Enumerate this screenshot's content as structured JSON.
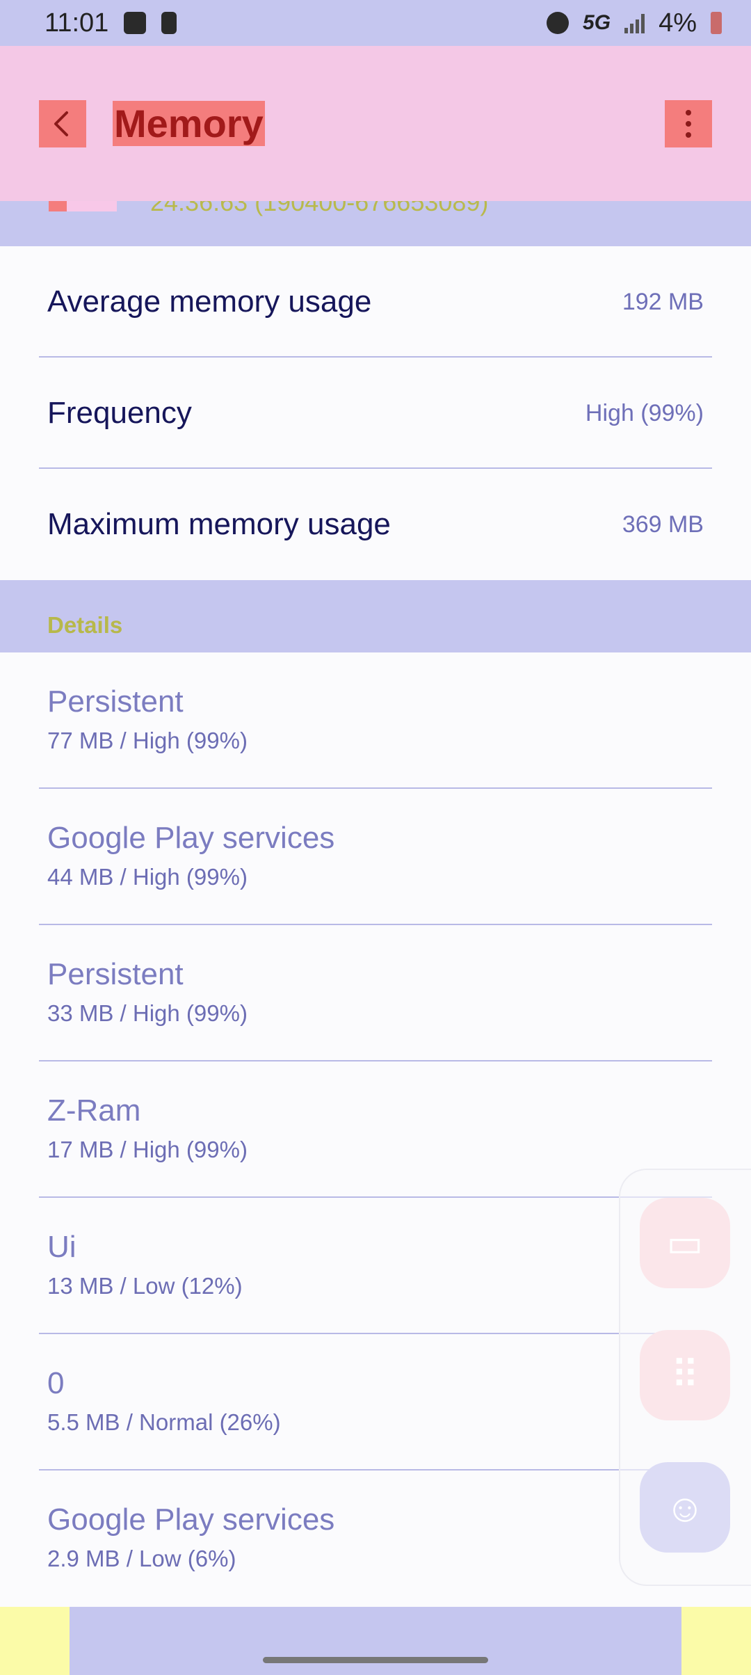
{
  "status_bar": {
    "time": "11:01",
    "network": "5G",
    "battery": "4%"
  },
  "header": {
    "title": "Memory"
  },
  "app_peek": {
    "version_text": "24.36.63 (190400-676653089)"
  },
  "summary": [
    {
      "label": "Average memory usage",
      "value": "192 MB"
    },
    {
      "label": "Frequency",
      "value": "High (99%)"
    },
    {
      "label": "Maximum memory usage",
      "value": "369 MB"
    }
  ],
  "details": {
    "title": "Details",
    "items": [
      {
        "name": "Persistent",
        "info": "77 MB / High (99%)"
      },
      {
        "name": "Google Play services",
        "info": "44 MB / High (99%)"
      },
      {
        "name": "Persistent",
        "info": "33 MB / High (99%)"
      },
      {
        "name": "Z-Ram",
        "info": "17 MB / High (99%)"
      },
      {
        "name": "Ui",
        "info": "13 MB / Low (12%)"
      },
      {
        "name": "0",
        "info": "5.5 MB / Normal (26%)"
      },
      {
        "name": "Google Play services",
        "info": "2.9 MB / Low (6%)"
      }
    ]
  }
}
